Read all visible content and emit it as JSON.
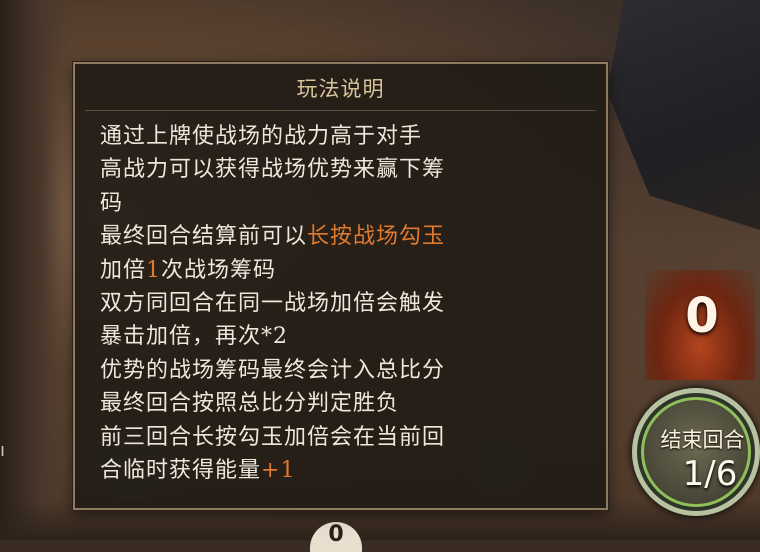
{
  "help_panel": {
    "title": "玩法说明",
    "lines": [
      {
        "parts": [
          "通过上牌使战场的战力高于对手"
        ]
      },
      {
        "parts": [
          "高战力可以获得战场优势来赢下筹"
        ]
      },
      {
        "parts": [
          "码"
        ]
      },
      {
        "parts": [
          "最终回合结算前可以",
          "长按战场勾玉"
        ]
      },
      {
        "parts": [
          "加倍",
          "1",
          "次战场筹码"
        ]
      },
      {
        "parts": [
          "双方同回合在同一战场加倍会触发"
        ]
      },
      {
        "parts": [
          "暴击加倍，再次*2"
        ]
      },
      {
        "parts": [
          "优势的战场筹码最终会计入总比分"
        ]
      },
      {
        "parts": [
          "最终回合按照总比分判定胜负"
        ]
      },
      {
        "parts": [
          "前三回合长按勾玉加倍会在当前回"
        ]
      },
      {
        "parts": [
          "合临时获得能量",
          "+1"
        ]
      }
    ]
  },
  "score_display": {
    "value": "0"
  },
  "end_round_button": {
    "label": "结束回合",
    "counter": "1/6"
  },
  "bottom_badge": {
    "value": "0"
  },
  "colors": {
    "highlight": "#e07a2f",
    "panel_text": "#efe8da",
    "panel_title": "#d9c39b",
    "ring": "#8fbf5a"
  }
}
